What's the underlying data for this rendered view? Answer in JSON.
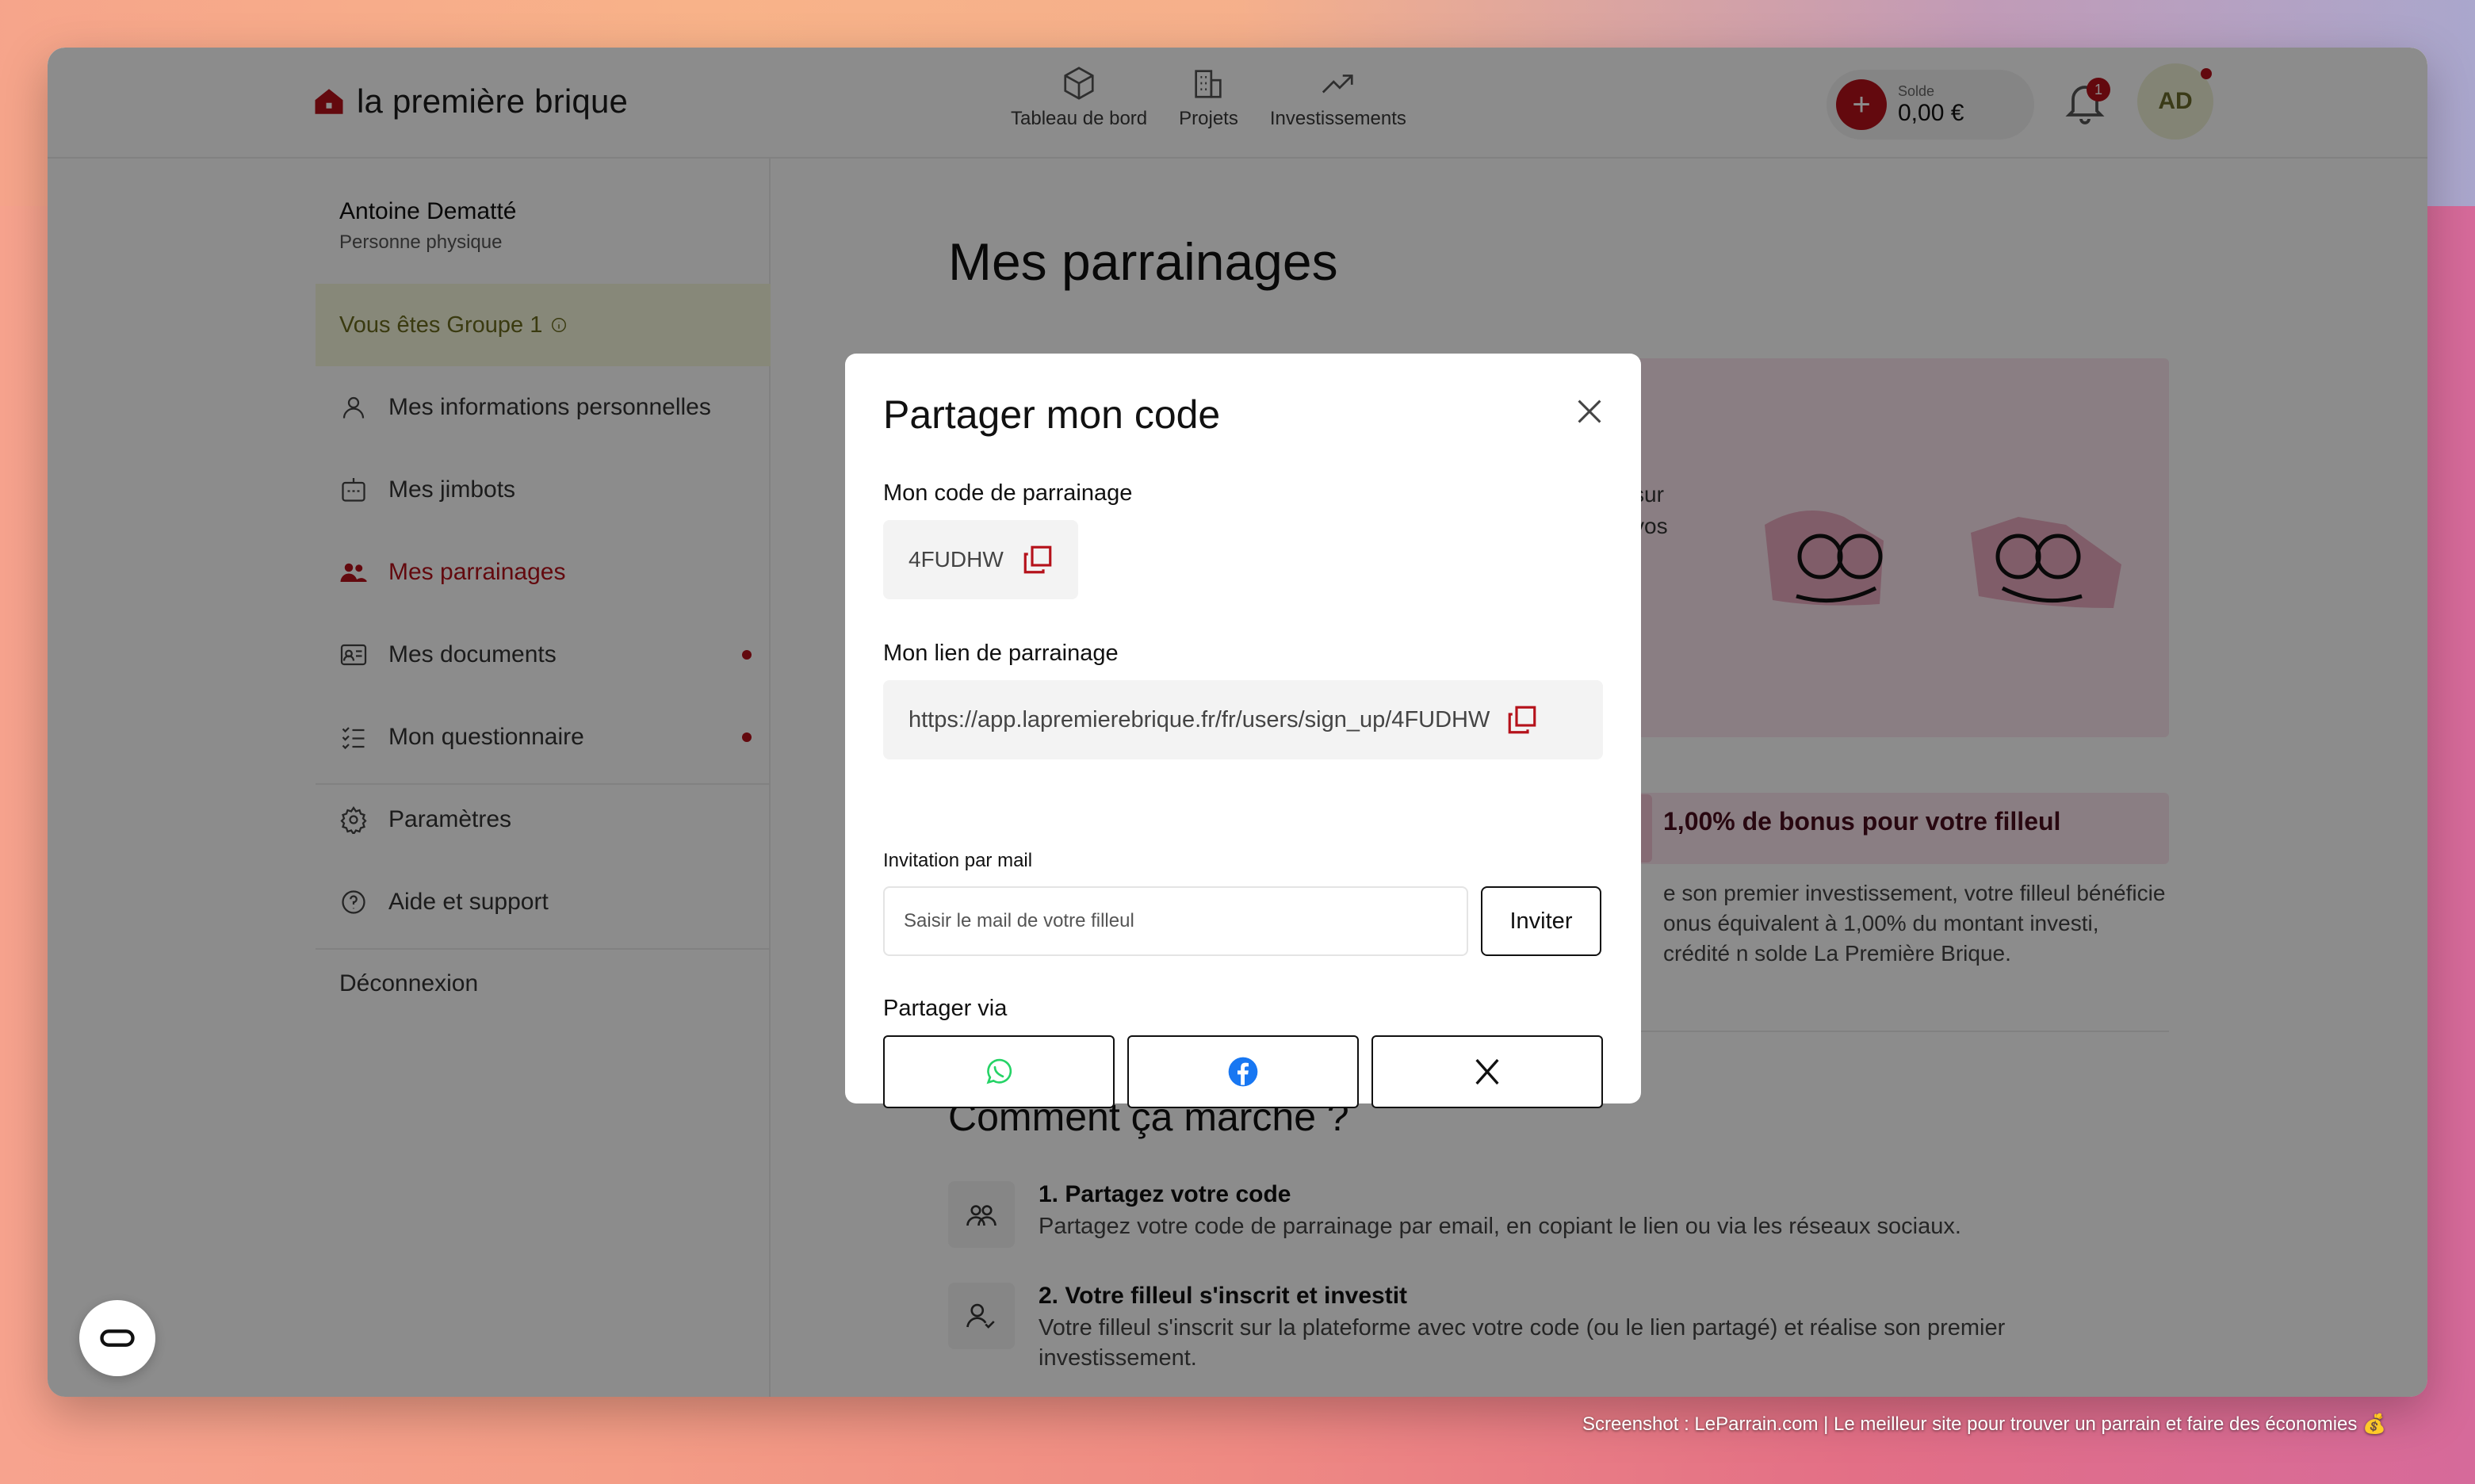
{
  "brand": {
    "name": "la première brique"
  },
  "nav": [
    {
      "label": "Tableau de bord",
      "icon": "box-icon"
    },
    {
      "label": "Projets",
      "icon": "building-icon"
    },
    {
      "label": "Investissements",
      "icon": "trending-up-icon"
    }
  ],
  "balance": {
    "label": "Solde",
    "value": "0,00 €"
  },
  "notifications": {
    "count": "1"
  },
  "avatar": {
    "initials": "AD"
  },
  "sidebar": {
    "user_name": "Antoine Dematté",
    "user_type": "Personne physique",
    "group": "Vous êtes Groupe 1",
    "items": [
      {
        "label": "Mes informations personnelles"
      },
      {
        "label": "Mes jimbots"
      },
      {
        "label": "Mes parrainages"
      },
      {
        "label": "Mes documents"
      },
      {
        "label": "Mon questionnaire"
      },
      {
        "label": "Paramètres"
      },
      {
        "label": "Aide et support"
      },
      {
        "label": "Déconnexion"
      }
    ]
  },
  "main": {
    "title": "Mes parrainages",
    "banner_fragment_1": "sur",
    "banner_fragment_2": "vos",
    "bonus_title": "1,00% de bonus pour votre filleul",
    "bonus_desc": "e son premier investissement, votre filleul bénéficie onus équivalent à 1,00% du montant investi, crédité n solde La Première Brique.",
    "how_title": "Comment ça marche ?",
    "steps": [
      {
        "title": "1. Partagez votre code",
        "desc": "Partagez votre code de parrainage par email, en copiant le lien ou via les réseaux sociaux."
      },
      {
        "title": "2. Votre filleul s'inscrit et investit",
        "desc": "Votre filleul s'inscrit sur la plateforme avec votre code (ou le lien partagé) et réalise son premier investissement."
      }
    ]
  },
  "modal": {
    "title": "Partager mon code",
    "code_label": "Mon code de parrainage",
    "code_value": "4FUDHW",
    "link_label": "Mon lien de parrainage",
    "link_value": "https://app.lapremierebrique.fr/fr/users/sign_up/4FUDHW",
    "mail_label": "Invitation par mail",
    "mail_placeholder": "Saisir le mail de votre filleul",
    "invite_label": "Inviter",
    "share_label": "Partager via",
    "share_options": [
      "whatsapp-icon",
      "facebook-icon",
      "x-icon"
    ]
  },
  "watermark": "Screenshot : LeParrain.com | Le meilleur site pour trouver un parrain et faire des économies 💰",
  "colors": {
    "accent": "#b5121b",
    "group_bg": "#f6f8dc",
    "banner_bg": "#fbe6ee"
  }
}
